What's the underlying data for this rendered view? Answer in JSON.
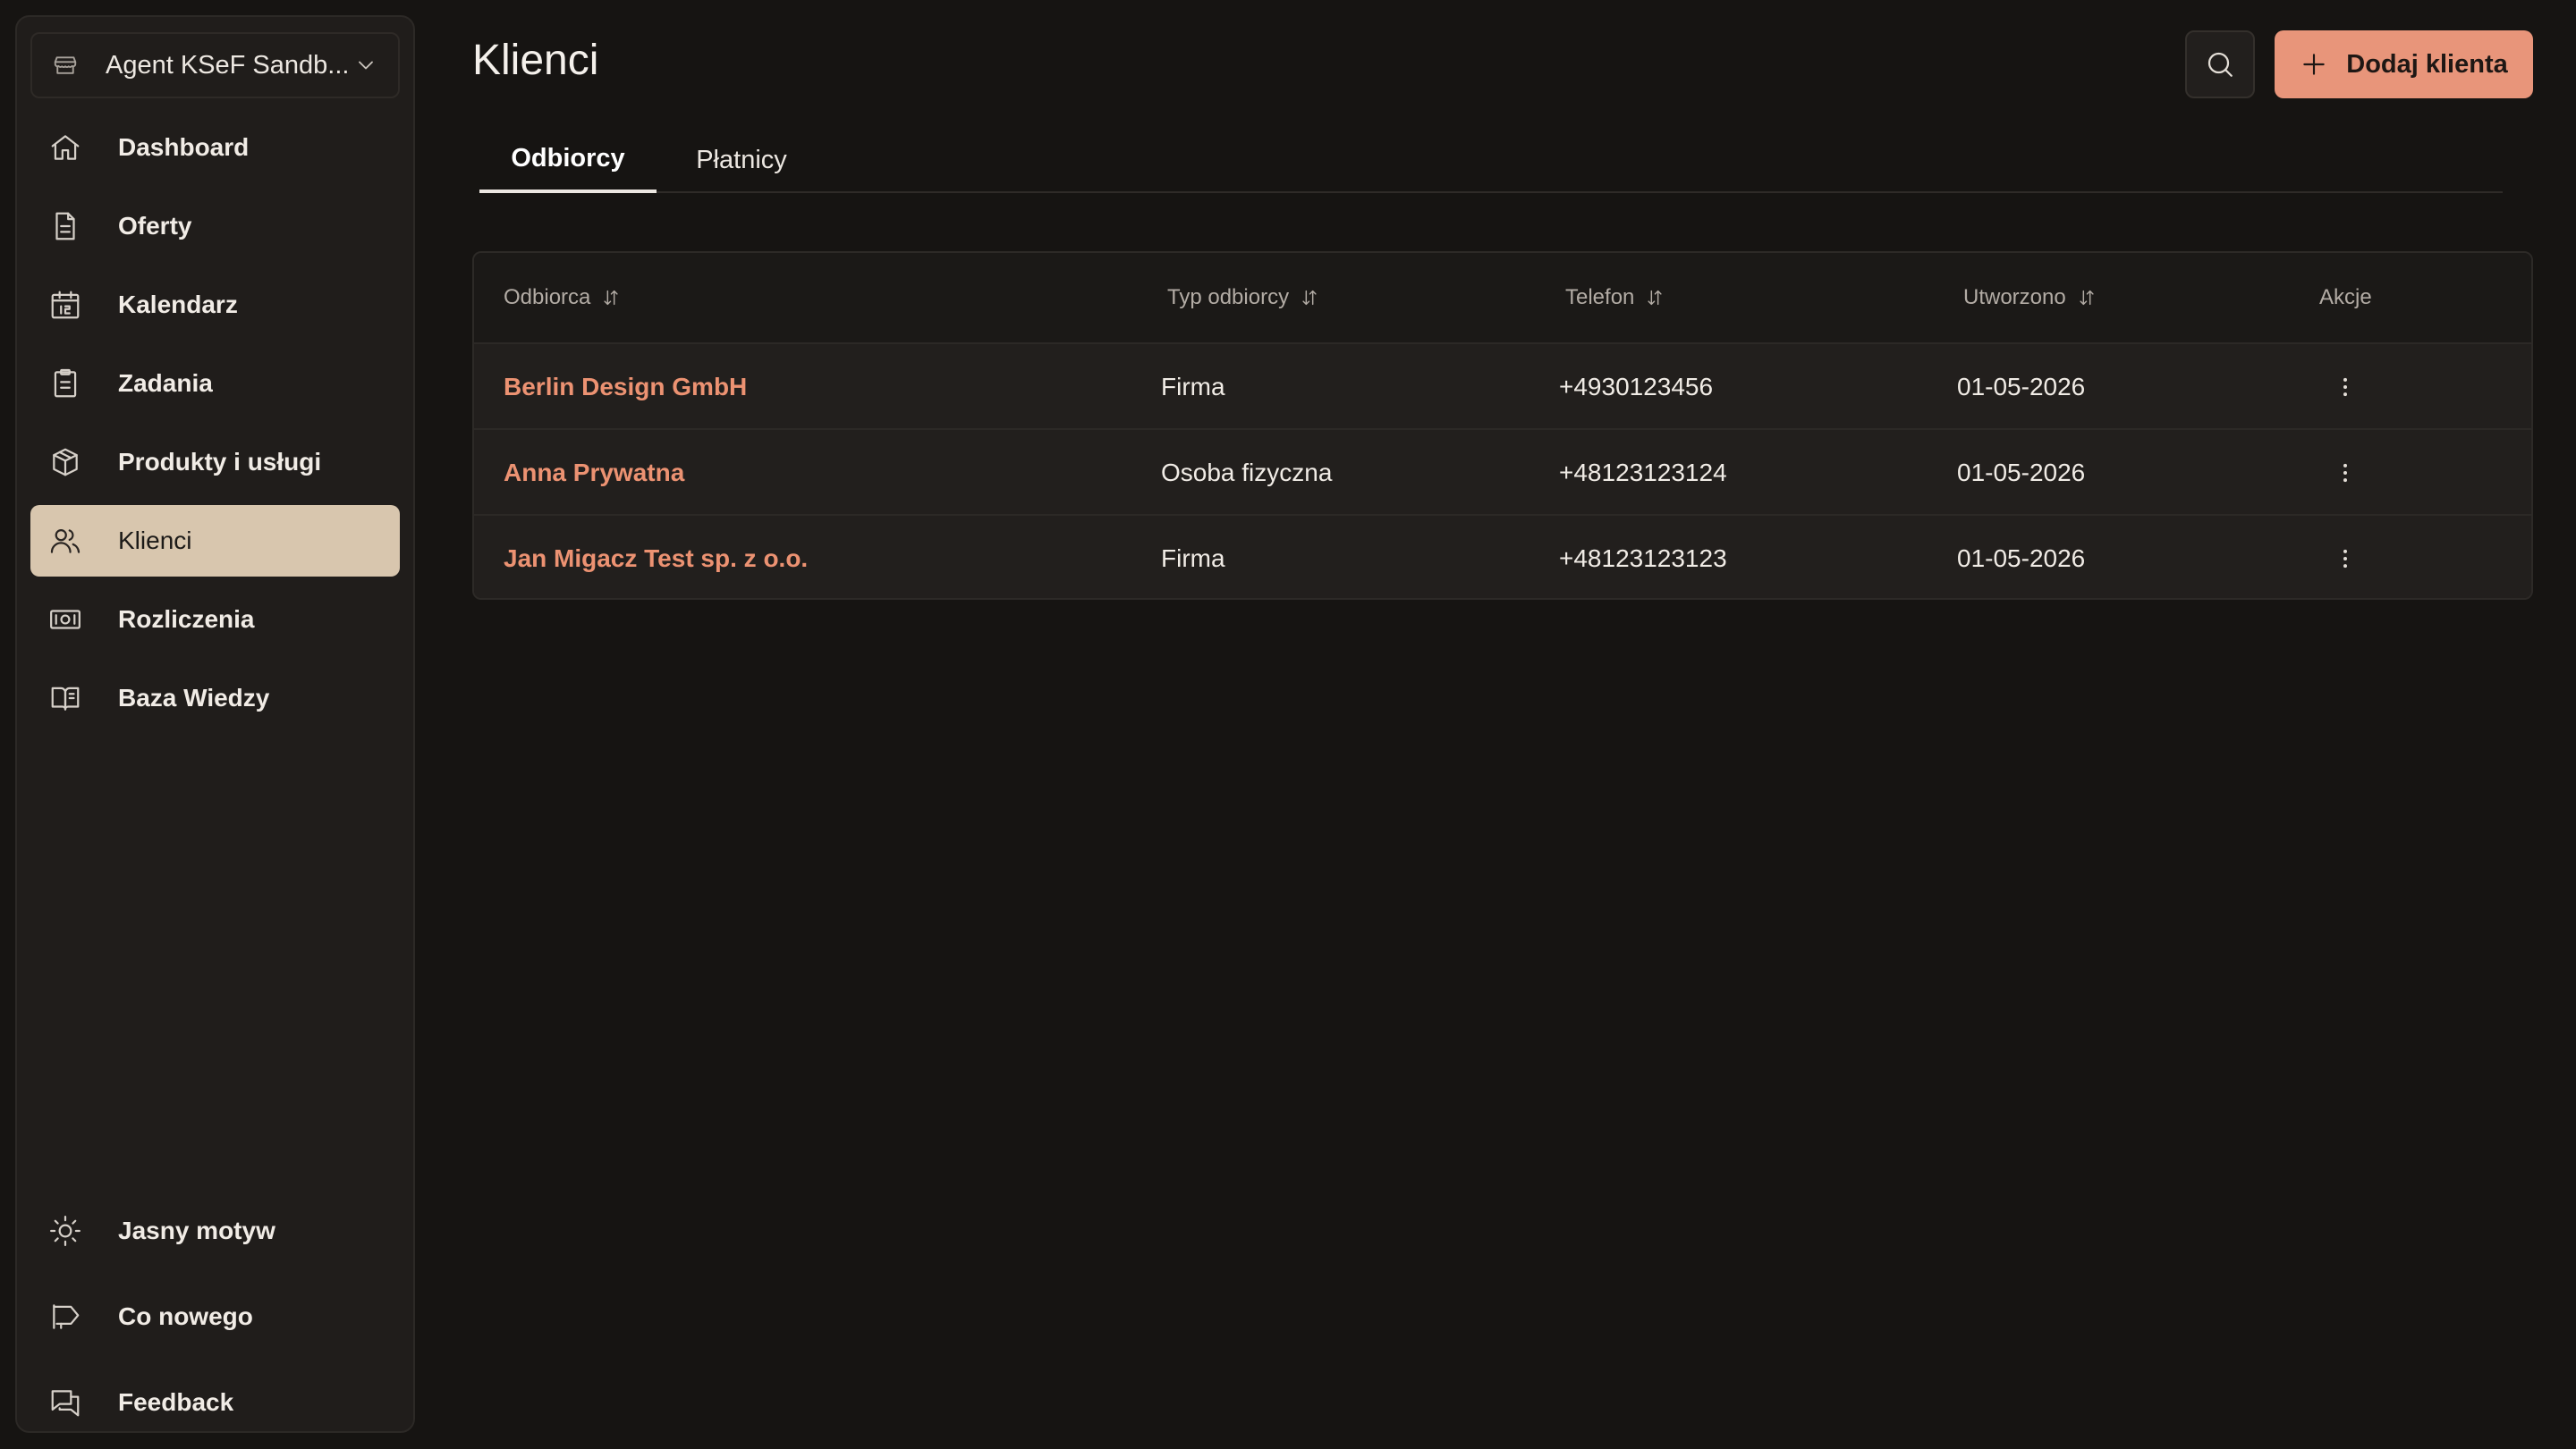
{
  "org": {
    "name": "Agent KSeF Sandb..."
  },
  "nav": {
    "items": [
      {
        "label": "Dashboard"
      },
      {
        "label": "Oferty"
      },
      {
        "label": "Kalendarz"
      },
      {
        "label": "Zadania"
      },
      {
        "label": "Produkty i usługi"
      },
      {
        "label": "Klienci"
      },
      {
        "label": "Rozliczenia"
      },
      {
        "label": "Baza Wiedzy"
      }
    ],
    "active": "Klienci",
    "bottom": [
      {
        "label": "Jasny motyw"
      },
      {
        "label": "Co nowego"
      },
      {
        "label": "Feedback"
      }
    ]
  },
  "header": {
    "title": "Klienci",
    "add_label": "Dodaj klienta"
  },
  "tabs": [
    {
      "label": "Odbiorcy",
      "active": true
    },
    {
      "label": "Płatnicy",
      "active": false
    }
  ],
  "table": {
    "columns": [
      "Odbiorca",
      "Typ odbiorcy",
      "Telefon",
      "Utworzono",
      "Akcje"
    ],
    "rows": [
      {
        "name": "Berlin Design GmbH",
        "type": "Firma",
        "phone": "+4930123456",
        "created": "01-05-2026"
      },
      {
        "name": "Anna Prywatna",
        "type": "Osoba fizyczna",
        "phone": "+48123123124",
        "created": "01-05-2026"
      },
      {
        "name": "Jan Migacz Test sp. z o.o.",
        "type": "Firma",
        "phone": "+48123123123",
        "created": "01-05-2026"
      }
    ]
  },
  "colors": {
    "background": "#161412",
    "sidebar": "#201d1b",
    "active_nav": "#d8c6ae",
    "accent": "#e8957a",
    "link": "#ec9272"
  }
}
